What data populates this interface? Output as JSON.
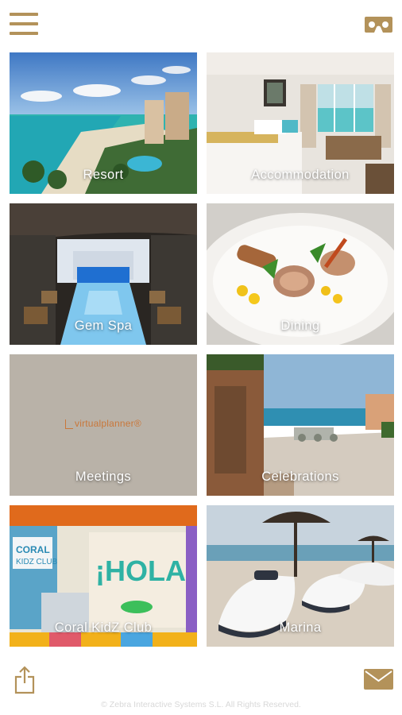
{
  "header": {
    "menu_icon": "hamburger-menu-icon",
    "vr_icon": "vr-headset-icon",
    "accent_color": "#b3925a"
  },
  "tiles": [
    {
      "label": "Resort",
      "image": "beach-resort-aerial-photo"
    },
    {
      "label": "Accommodation",
      "image": "hotel-room-ocean-view-photo"
    },
    {
      "label": "Gem Spa",
      "image": "indoor-spa-pool-photo"
    },
    {
      "label": "Dining",
      "image": "plated-gourmet-dish-photo"
    },
    {
      "label": "Meetings",
      "image": "virtualplanner-logo",
      "logo_text": "virtualplanner®"
    },
    {
      "label": "Celebrations",
      "image": "seaside-terrace-photo"
    },
    {
      "label": "Coral KidZ Club",
      "image": "kids-club-room-photo"
    },
    {
      "label": "Marina",
      "image": "jet-skis-on-beach-photo"
    }
  ],
  "footer": {
    "share_icon": "share-icon",
    "mail_icon": "envelope-icon",
    "copyright": "© Zebra Interactive Systems S.L. All Rights Reserved."
  }
}
